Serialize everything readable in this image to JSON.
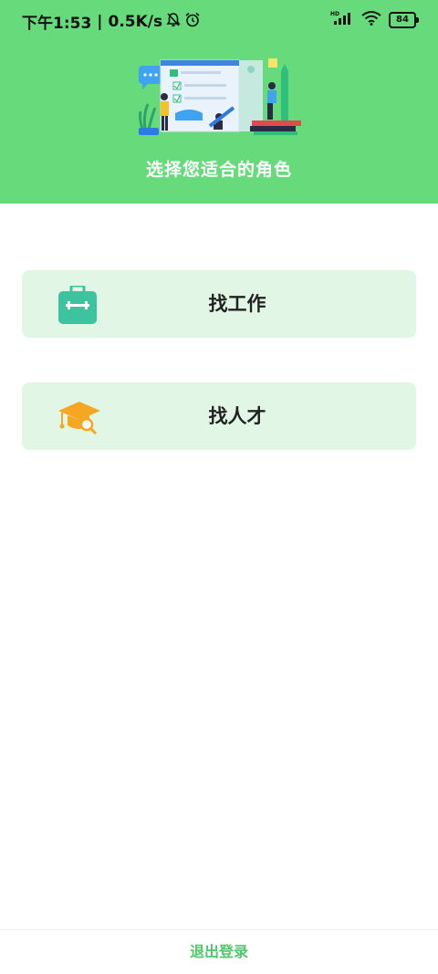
{
  "status_bar": {
    "time": "下午1:53",
    "separator": "|",
    "network_speed": "0.5K/s",
    "network_type": "HD",
    "battery": "84",
    "icons": [
      "bell-muted-icon",
      "alarm-icon",
      "signal-icon",
      "wifi-icon",
      "battery-icon"
    ]
  },
  "header": {
    "title": "选择您适合的角色",
    "background_color": "#67db7c"
  },
  "roles": [
    {
      "label": "找工作",
      "icon": "briefcase-icon",
      "icon_color": "#3dc49f"
    },
    {
      "label": "找人才",
      "icon": "graduation-cap-search-icon",
      "icon_color": "#f5a623"
    }
  ],
  "footer": {
    "logout_label": "退出登录"
  },
  "colors": {
    "accent": "#4fc76b",
    "card_background": "#e2f6e5"
  }
}
